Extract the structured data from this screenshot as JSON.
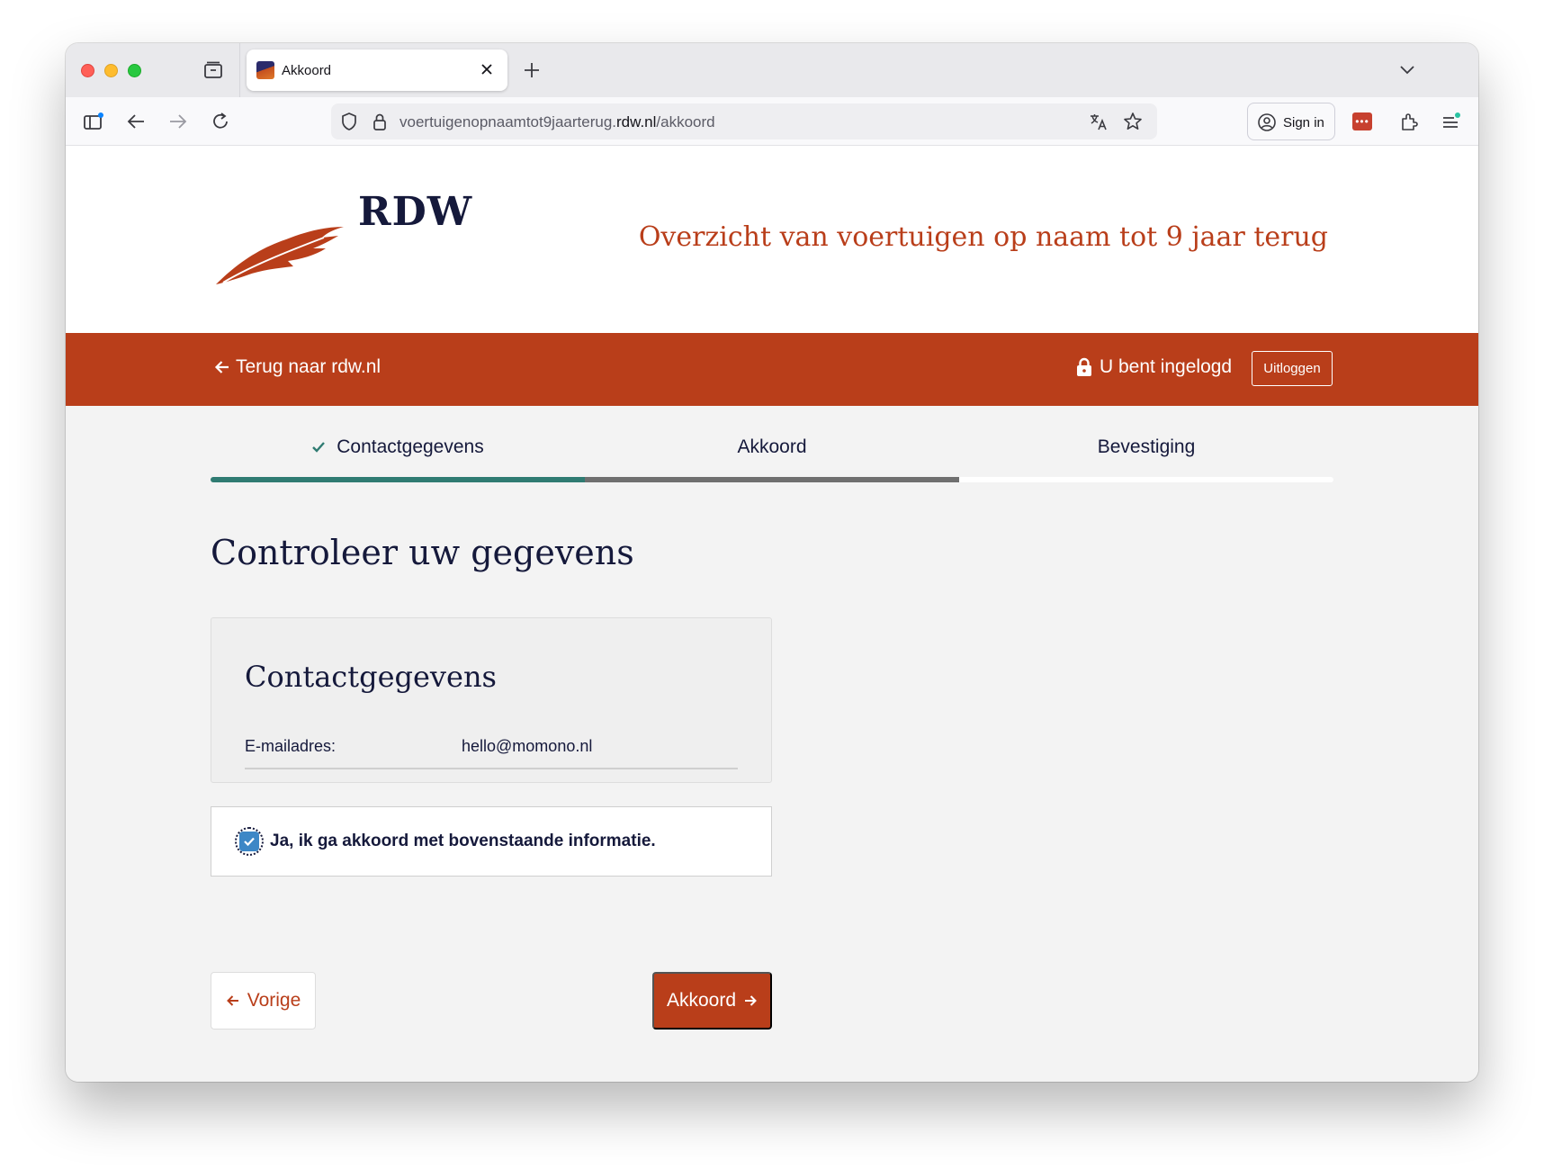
{
  "browser": {
    "tab": {
      "title": "Akkoord"
    },
    "url": {
      "prefix": "voertuigenopnaamtot9jaarterug.",
      "domain": "rdw.nl",
      "path": "/akkoord"
    },
    "signin_label": "Sign in",
    "extension_glyph": "•••"
  },
  "header": {
    "logo_text": "RDW",
    "site_title": "Overzicht van voertuigen op naam tot 9 jaar terug",
    "brand_color": "#b93e1a"
  },
  "topbar": {
    "back_label": "Terug naar rdw.nl",
    "logged_in_label": "U bent ingelogd",
    "logout_label": "Uitloggen"
  },
  "steps": [
    {
      "label": "Contactgegevens",
      "status": "done"
    },
    {
      "label": "Akkoord",
      "status": "current"
    },
    {
      "label": "Bevestiging",
      "status": "upcoming"
    }
  ],
  "main": {
    "heading": "Controleer uw gegevens",
    "contact_card": {
      "title": "Contactgegevens",
      "rows": [
        {
          "label": "E-mailadres:",
          "value": "hello@momono.nl"
        }
      ]
    },
    "agree": {
      "label": "Ja, ik ga akkoord met bovenstaande informatie.",
      "checked": true
    },
    "prev_label": "Vorige",
    "next_label": "Akkoord"
  }
}
